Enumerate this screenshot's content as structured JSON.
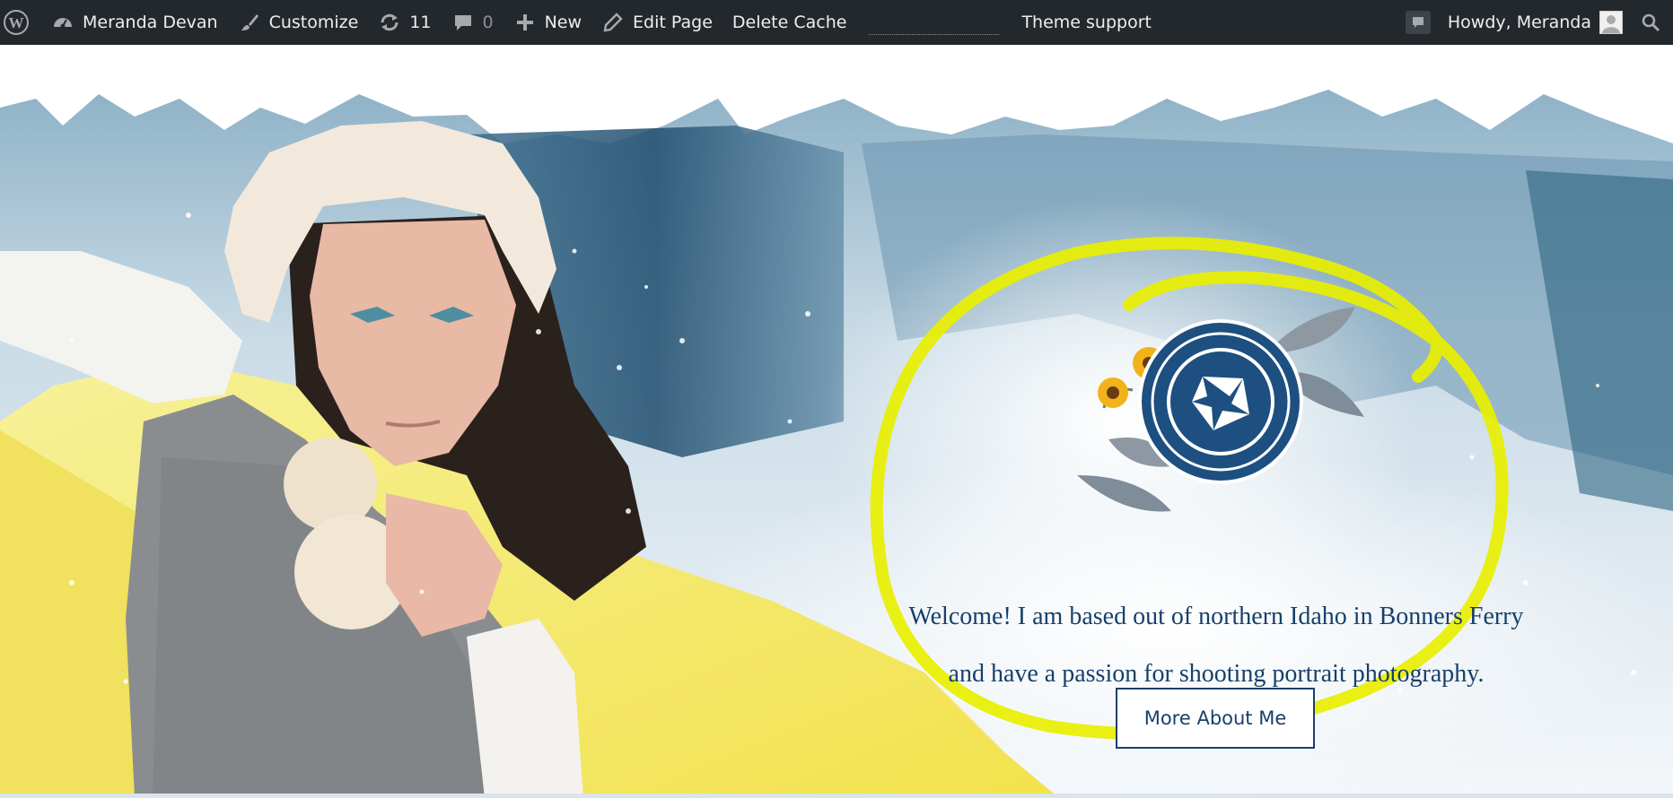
{
  "adminbar": {
    "site_name": "Meranda Devan",
    "customize": "Customize",
    "updates_count": "11",
    "comments_count": "0",
    "new_label": "New",
    "edit_page": "Edit Page",
    "delete_cache": "Delete Cache",
    "theme_support": "Theme support",
    "greeting": "Howdy, Meranda",
    "icons": [
      "wordpress-logo-icon",
      "dashboard-icon",
      "paintbrush-icon",
      "refresh-icon",
      "comment-icon",
      "plus-icon",
      "pencil-icon",
      "notification-icon",
      "avatar-icon",
      "search-icon"
    ]
  },
  "hero": {
    "welcome_line1": "Welcome! I am based out of northern Idaho in Bonners Ferry",
    "welcome_line2": "and have a passion for shooting portrait photography.",
    "cta_label": "More About Me",
    "logo": "camera-aperture-laurel-logo",
    "highlight_color": "#e8ef00",
    "accent_color": "#17406b"
  }
}
